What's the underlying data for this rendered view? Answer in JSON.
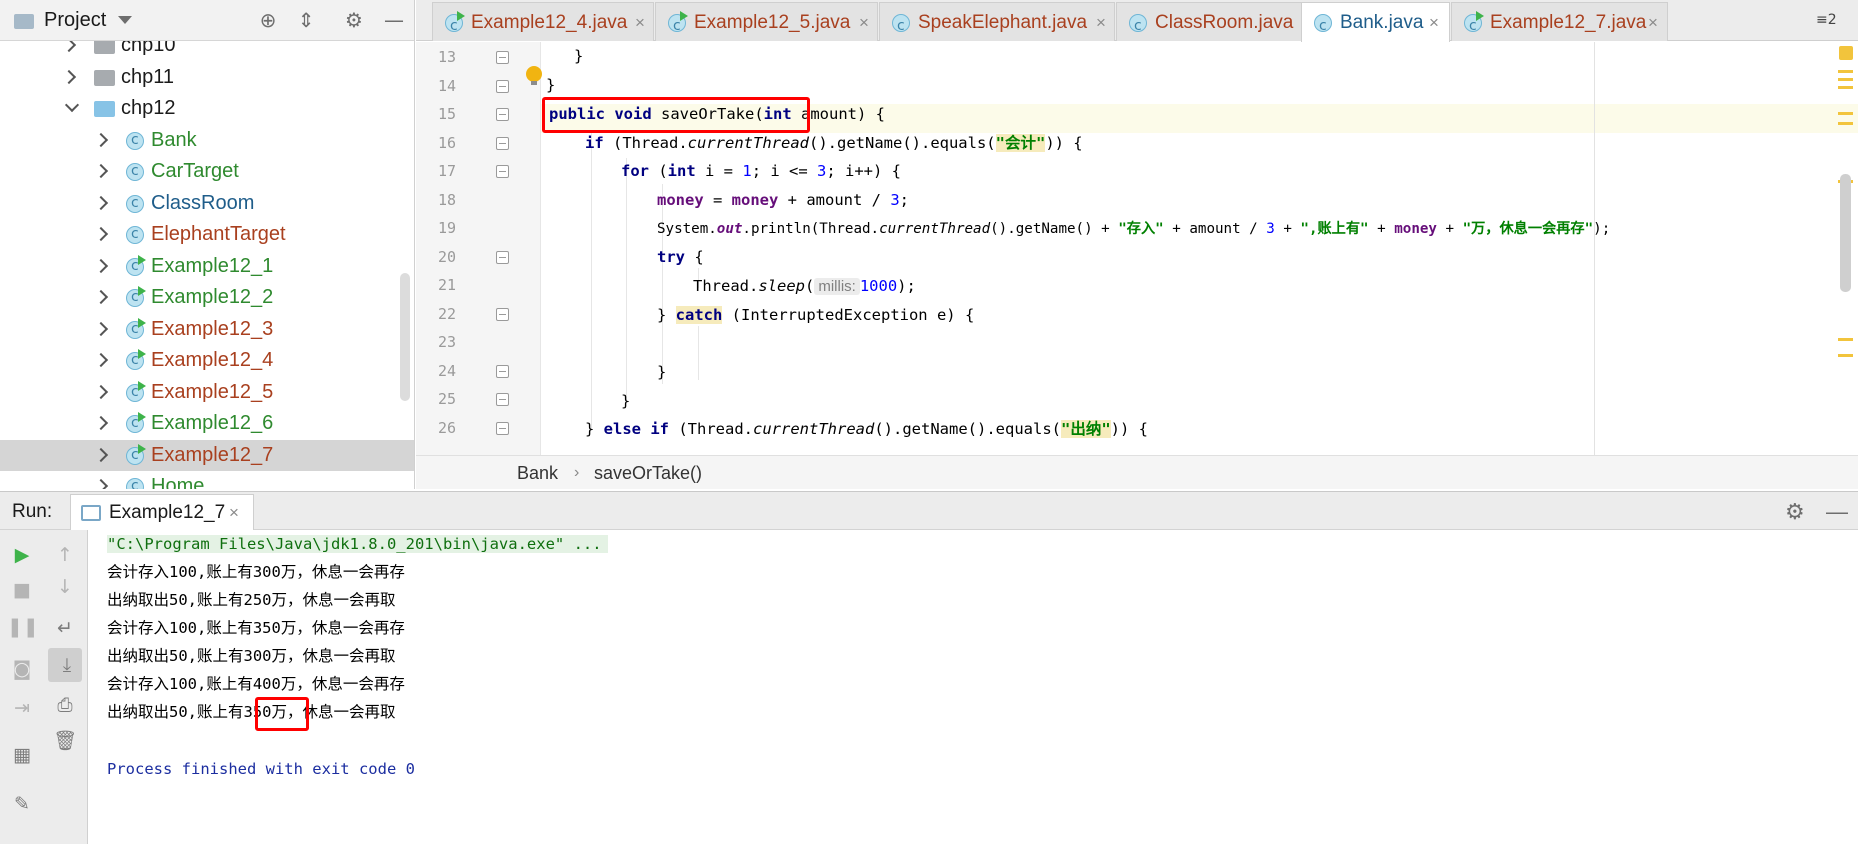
{
  "project_panel": {
    "title": "Project",
    "tree": [
      {
        "label": "chp10",
        "kind": "folder-grey",
        "expanded": false,
        "color": "black"
      },
      {
        "label": "chp11",
        "kind": "folder-grey",
        "expanded": false,
        "color": "black"
      },
      {
        "label": "chp12",
        "kind": "folder-blue",
        "expanded": true,
        "color": "black"
      },
      {
        "label": "Bank",
        "kind": "class",
        "color": "green"
      },
      {
        "label": "CarTarget",
        "kind": "class",
        "color": "green"
      },
      {
        "label": "ClassRoom",
        "kind": "class",
        "color": "blue"
      },
      {
        "label": "ElephantTarget",
        "kind": "class",
        "color": "red"
      },
      {
        "label": "Example12_1",
        "kind": "runnable",
        "color": "green"
      },
      {
        "label": "Example12_2",
        "kind": "runnable",
        "color": "green"
      },
      {
        "label": "Example12_3",
        "kind": "runnable",
        "color": "red"
      },
      {
        "label": "Example12_4",
        "kind": "runnable",
        "color": "red"
      },
      {
        "label": "Example12_5",
        "kind": "runnable",
        "color": "red"
      },
      {
        "label": "Example12_6",
        "kind": "runnable",
        "color": "green"
      },
      {
        "label": "Example12_7",
        "kind": "runnable",
        "color": "red",
        "selected": true
      },
      {
        "label": "Home",
        "kind": "class",
        "color": "green"
      }
    ]
  },
  "tabs": [
    {
      "label": "Example12_4.java",
      "icon": "runnable-class-icon",
      "active": false
    },
    {
      "label": "Example12_5.java",
      "icon": "runnable-class-icon",
      "active": false
    },
    {
      "label": "SpeakElephant.java",
      "icon": "class-icon",
      "active": false
    },
    {
      "label": "ClassRoom.java",
      "icon": "class-icon",
      "active": false
    },
    {
      "label": "Bank.java",
      "icon": "class-icon",
      "active": true
    },
    {
      "label": "Example12_7.java",
      "icon": "runnable-class-icon",
      "active": false
    }
  ],
  "tab_overflow": "≡2",
  "editor": {
    "line_numbers": [
      "13",
      "14",
      "15",
      "16",
      "17",
      "18",
      "19",
      "20",
      "21",
      "22",
      "23",
      "24",
      "25",
      "26"
    ],
    "code": {
      "l13": "}",
      "l14": "}",
      "l15": {
        "kw1": "public",
        "kw2": "void",
        "name": "saveOrTake(",
        "kw3": "int",
        "rest": " amount)",
        "brace": " {"
      },
      "l16": {
        "kw": "if",
        "a": " (Thread.",
        "it": "currentThread",
        "b": "().getName().equals(",
        "str": "\"会计\"",
        "c": ")) {"
      },
      "l17": {
        "kw": "for",
        "a": " (",
        "kw2": "int",
        "b": " i = ",
        "n1": "1",
        "c": "; i <= ",
        "n2": "3",
        "d": "; i++) {"
      },
      "l18": {
        "f1": "money",
        "a": " = ",
        "f2": "money",
        "b": " + amount / ",
        "n": "3",
        "c": ";"
      },
      "l19": {
        "a": "System.",
        "it": "out",
        "b": ".println(Thread.",
        "it2": "currentThread",
        "c": "().getName() + ",
        "s1": "\"存入\"",
        "d": " + amount / ",
        "n": "3",
        "e": " + ",
        "s2": "\",账上有\"",
        "f": " + ",
        "fld": "money",
        "g": " + ",
        "s3": "\"万，休息一会再存\"",
        "h": ");"
      },
      "l20": {
        "kw": "try",
        "a": " {"
      },
      "l21": {
        "a": "Thread.",
        "it": "sleep",
        "b": "(",
        "hint": "millis:",
        "n": "1000",
        "c": ");"
      },
      "l22": {
        "a": "} ",
        "kw": "catch",
        "b": " (InterruptedException e) {"
      },
      "l23": "",
      "l24": "}",
      "l25": "}",
      "l26": {
        "a": "} ",
        "kw1": "else",
        "b": " ",
        "kw2": "if",
        "c": " (Thread.",
        "it": "currentThread",
        "d": "().getName().equals(",
        "str": "\"出纳\"",
        "e": ")) {"
      }
    }
  },
  "breadcrumb": {
    "class": "Bank",
    "method": "saveOrTake()"
  },
  "run": {
    "label": "Run:",
    "tab": "Example12_7",
    "console": {
      "command": "\"C:\\Program Files\\Java\\jdk1.8.0_201\\bin\\java.exe\" ...",
      "lines": [
        "会计存入100,账上有300万，休息一会再存",
        "出纳取出50,账上有250万，休息一会再取",
        "会计存入100,账上有350万，休息一会再存",
        "出纳取出50,账上有300万，休息一会再取",
        "会计存入100,账上有400万，休息一会再存",
        "出纳取出50,账上有350万，休息一会再取"
      ],
      "exit": "Process finished with exit code 0"
    }
  }
}
